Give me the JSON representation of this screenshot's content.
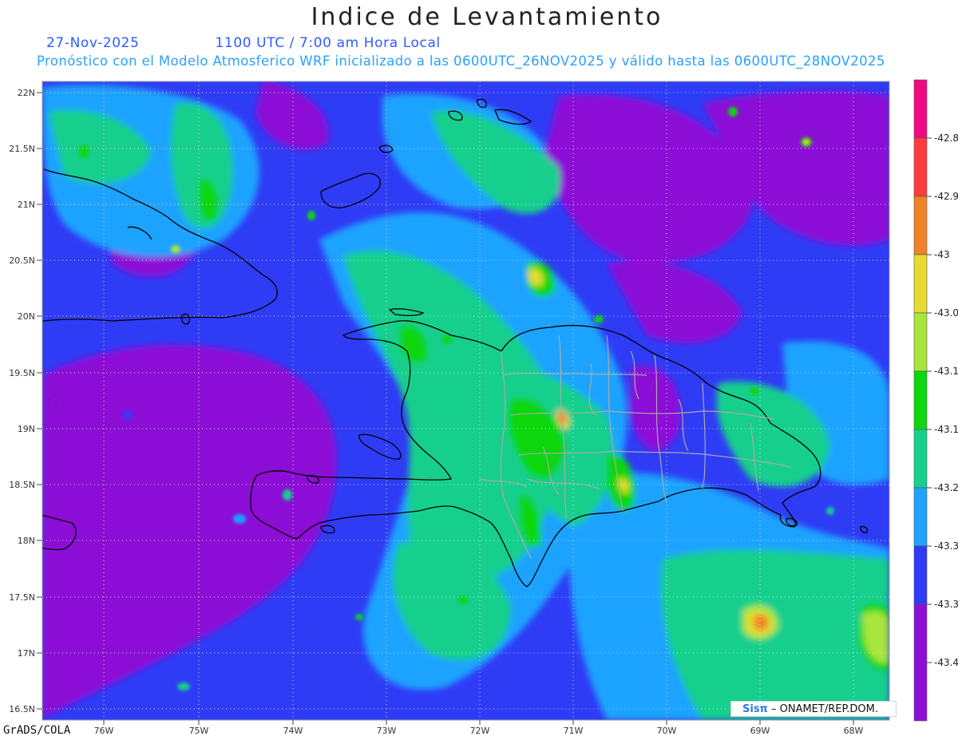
{
  "header": {
    "title": "Indice de Levantamiento",
    "date": "27-Nov-2025",
    "time": "1100 UTC / 7:00 am Hora Local",
    "forecast_note": "Pronóstico con el Modelo Atmosferico WRF inicializado a las 0600UTC_26NOV2025 y válido hasta las  0600UTC_28NOV2025"
  },
  "map": {
    "lat_labels": [
      "22N",
      "21.5N",
      "21N",
      "20.5N",
      "20N",
      "19.5N",
      "19N",
      "18.5N",
      "18N",
      "17.5N",
      "17N",
      "16.5N"
    ],
    "lon_labels": [
      "76W",
      "75W",
      "74W",
      "73W",
      "72W",
      "71W",
      "70W",
      "69W",
      "68W"
    ],
    "lat_range": [
      16.5,
      22.0
    ],
    "lon_range": [
      -76.6,
      -67.6
    ],
    "shading_colors": {
      "purple": "#8c0fd6",
      "blue": "#2f3cf5",
      "lightblue": "#1ea3ff",
      "teal": "#19cf8c",
      "green": "#10d610",
      "yellowgreen": "#a8e63c",
      "yellow": "#e6dc32",
      "orange": "#f08228",
      "red": "#fa3c3c",
      "magenta": "#f00a82"
    }
  },
  "colorbar": {
    "labels": [
      "-42.8",
      "-42.9",
      "-43",
      "-43.0",
      "-43.1",
      "-43.1",
      "-43.2",
      "-43.3",
      "-43.3",
      "-43.4"
    ],
    "colors": [
      "#f00a82",
      "#fa3c3c",
      "#f08228",
      "#e6dc32",
      "#a8e63c",
      "#10d610",
      "#19cf8c",
      "#1ea3ff",
      "#2f3cf5",
      "#8c0fd6"
    ]
  },
  "footer": {
    "credit": "GrADS/COLA",
    "badge_brand": "Sisπ",
    "badge_text": "– ONAMET/REP.DOM."
  }
}
